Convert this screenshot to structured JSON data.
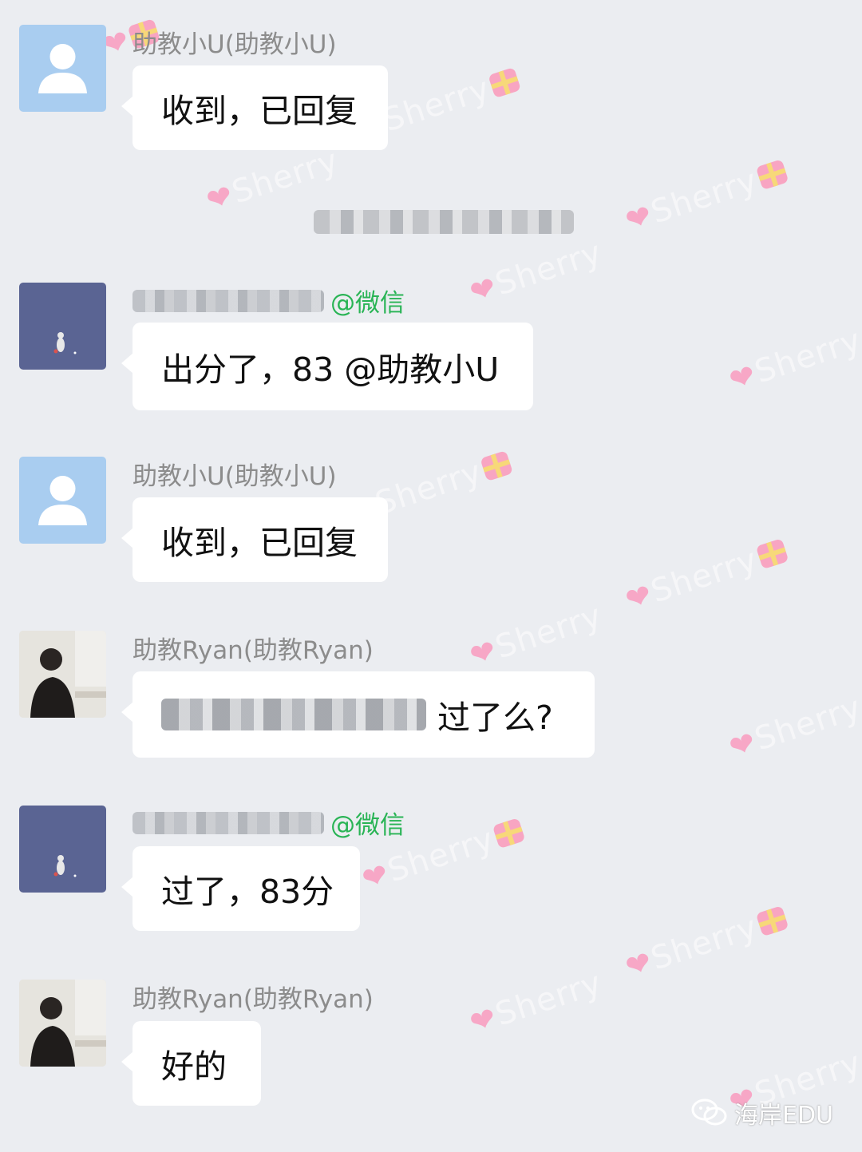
{
  "watermark": {
    "text": "Sherry"
  },
  "messages": [
    {
      "sender": "助教小U(助教小U)",
      "text": "收到，已回复"
    },
    {
      "sender_suffix": "@微信",
      "text": "出分了，83 @助教小U"
    },
    {
      "sender": "助教小U(助教小U)",
      "text": "收到，已回复"
    },
    {
      "sender": "助教Ryan(助教Ryan)",
      "text": "过了么?"
    },
    {
      "sender_suffix": "@微信",
      "text": "过了，83分"
    },
    {
      "sender": "助教Ryan(助教Ryan)",
      "text": "好的"
    }
  ],
  "footer": {
    "brand": "海岸EDU",
    "icon": "wechat-official-account-icon"
  },
  "colors": {
    "background": "#ebedf1",
    "bubble": "#ffffff",
    "wechat_green": "#29b455",
    "name_gray": "#8c8c8c"
  }
}
